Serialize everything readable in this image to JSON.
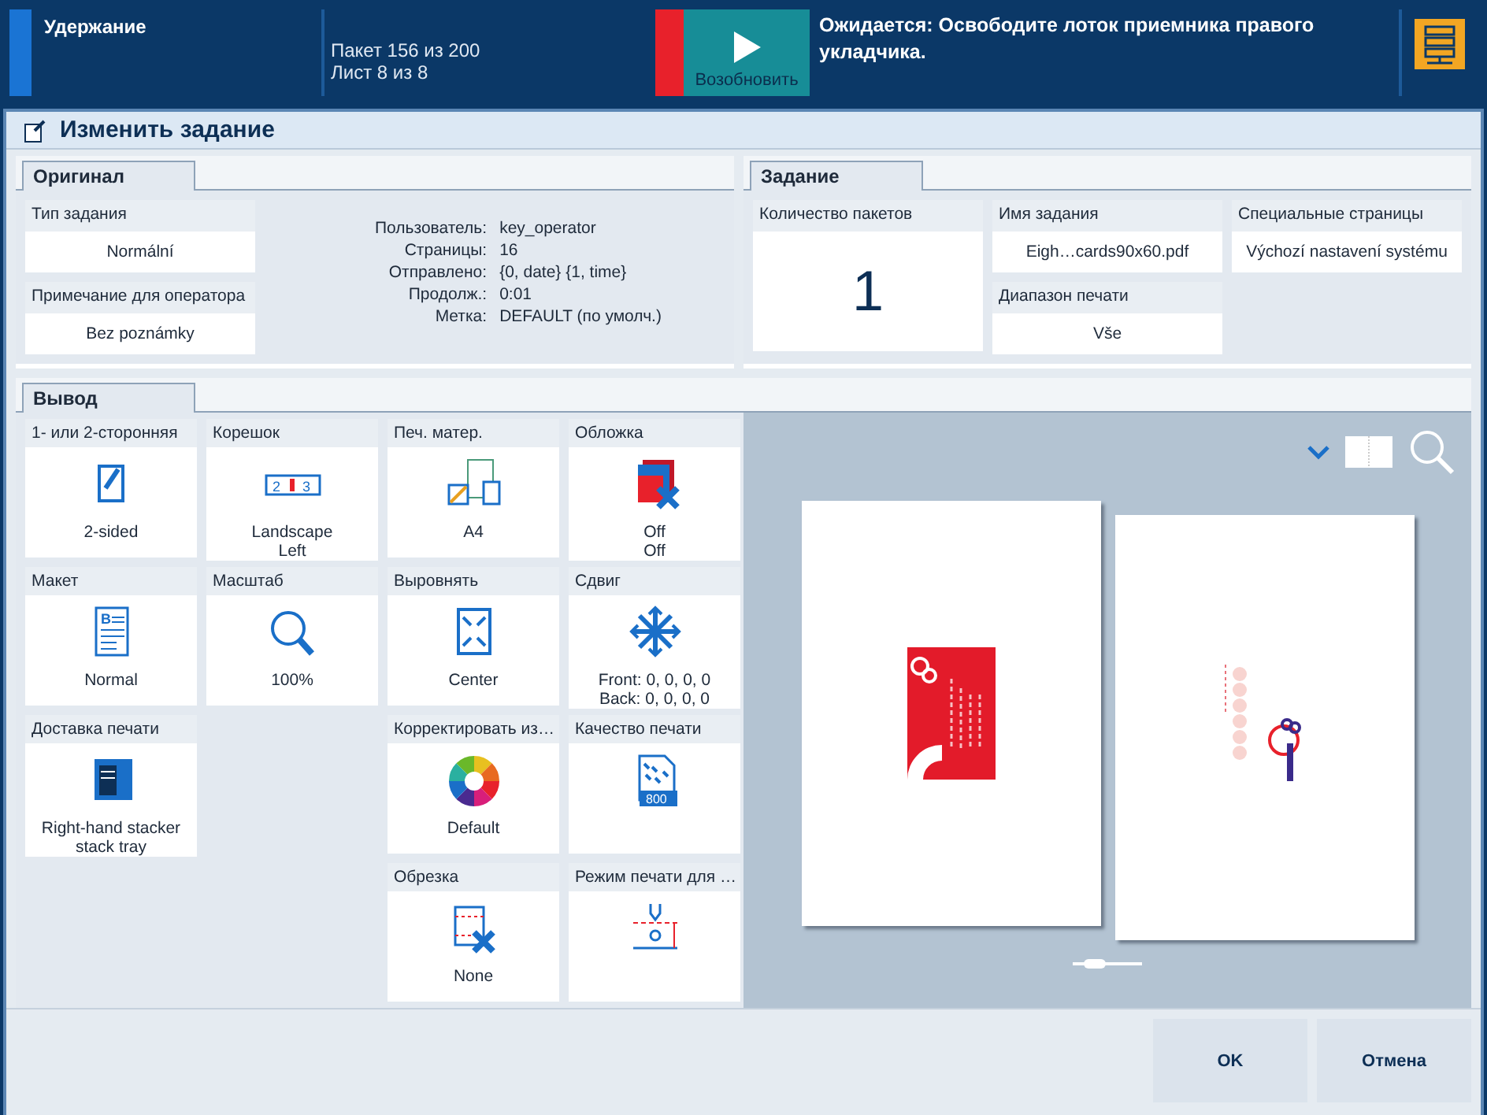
{
  "status_bar": {
    "state": "Удержание",
    "batch": "Пакет 156 из 200",
    "sheet": "Лист 8 из 8",
    "alert": true,
    "resume_label": "Возобновить",
    "message": "Ожидается: Освободите лоток приемника правого укладчика."
  },
  "dialog": {
    "title": "Изменить задание"
  },
  "original": {
    "tab": "Оригинал",
    "fields": [
      {
        "label": "Тип задания",
        "value": "Normální"
      },
      {
        "label": "Примечание для оператора",
        "value": "Bez poznámky"
      }
    ],
    "info": [
      {
        "label": "Пользователь:",
        "value": "key_operator"
      },
      {
        "label": "Страницы:",
        "value": "16"
      },
      {
        "label": "Отправлено:",
        "value": "{0, date} {1, time}"
      },
      {
        "label": "Продолж.:",
        "value": "0:01"
      },
      {
        "label": "Метка:",
        "value": "DEFAULT (по умолч.)"
      }
    ]
  },
  "job": {
    "tab": "Задание",
    "copies": {
      "label": "Количество пакетов",
      "value": "1"
    },
    "name": {
      "label": "Имя задания",
      "value": "Eigh…cards90x60.pdf"
    },
    "range": {
      "label": "Диапазон печати",
      "value": "Vše"
    },
    "special": {
      "label": "Специальные страницы",
      "value": "Výchozí nastavení systému"
    }
  },
  "output": {
    "tab": "Вывод",
    "tiles": [
      {
        "kind": "duplex",
        "label": "1- или 2-сторонняя",
        "lines": [
          "2-sided"
        ]
      },
      {
        "kind": "binding",
        "label": "Корешок",
        "lines": [
          "Landscape",
          "Left"
        ],
        "icon_text": [
          "2",
          "3"
        ]
      },
      {
        "kind": "media",
        "label": "Печ. матер.",
        "lines": [
          "A4"
        ]
      },
      {
        "kind": "cover",
        "label": "Обложка",
        "lines": [
          "Off",
          "Off"
        ]
      },
      {
        "kind": "layout",
        "label": "Макет",
        "lines": [
          "Normal"
        ],
        "icon_text": [
          "B"
        ]
      },
      {
        "kind": "zoom",
        "label": "Масштаб",
        "lines": [
          "100%"
        ]
      },
      {
        "kind": "align",
        "label": "Выровнять",
        "lines": [
          "Center"
        ]
      },
      {
        "kind": "shift",
        "label": "Сдвиг",
        "lines": [
          "Front: 0, 0, 0, 0",
          "Back: 0, 0, 0, 0"
        ]
      },
      {
        "kind": "delivery",
        "label": "Доставка печати",
        "lines": [
          "Right-hand stacker",
          "stack tray"
        ]
      },
      {
        "kind": "color",
        "label": "Корректировать из…",
        "lines": [
          "Default"
        ]
      },
      {
        "kind": "quality",
        "label": "Качество печати",
        "icon_text": [
          "800"
        ]
      },
      {
        "kind": "trim",
        "label": "Обрезка",
        "lines": [
          "None"
        ]
      },
      {
        "kind": "mode",
        "label": "Режим печати для …"
      }
    ]
  },
  "preview": {
    "zoom": {
      "level": 0.2
    }
  },
  "buttons": [
    "OK",
    "Отмена"
  ]
}
